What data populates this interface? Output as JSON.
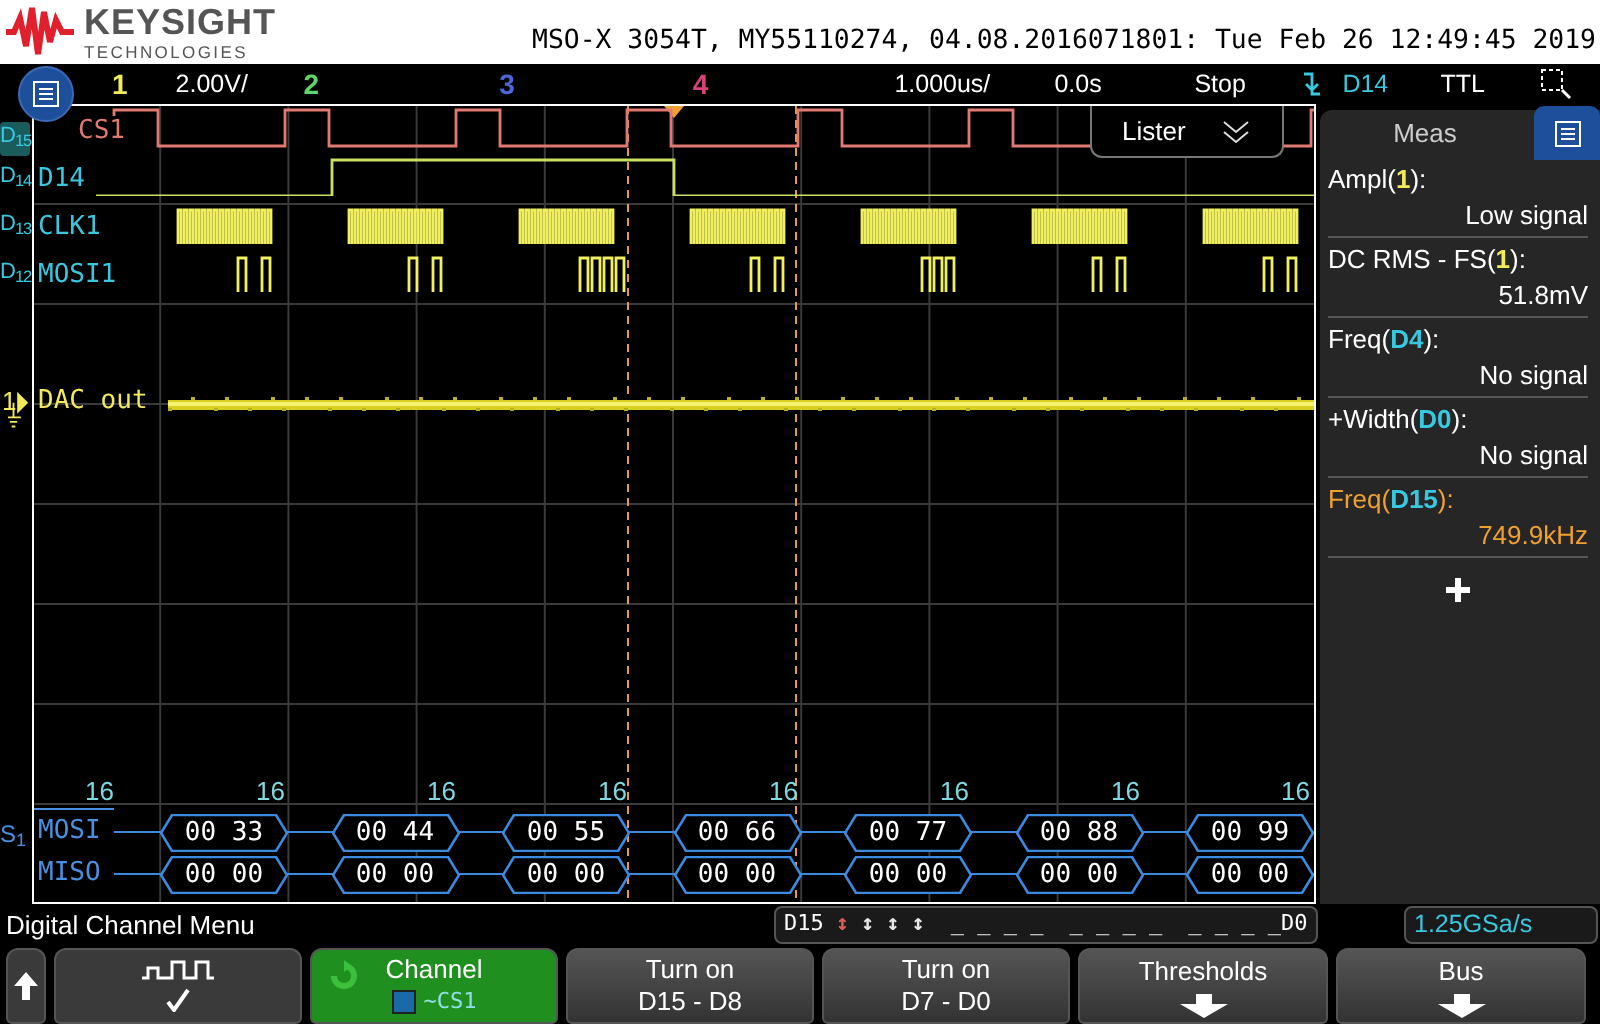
{
  "header": {
    "brand": "KEYSIGHT",
    "brand_sub": "TECHNOLOGIES",
    "title": "MSO-X 3054T, MY55110274, 04.08.2016071801: Tue Feb 26 12:49:45 2019"
  },
  "status_bar": {
    "channels": [
      {
        "label": "1",
        "color": "#f2ea5a"
      },
      {
        "label": "2",
        "color": "#5fd468"
      },
      {
        "label": "3",
        "color": "#4a66d8"
      },
      {
        "label": "4",
        "color": "#d8407a"
      }
    ],
    "scale": "2.00V/",
    "timebase": "1.000us/",
    "delay": "0.0s",
    "run_state": "Stop",
    "trigger_source": "D14",
    "trigger_level": "TTL"
  },
  "traces": [
    {
      "tag": "D$_{15}$",
      "label": "CS1",
      "kind": "select",
      "selected": true
    },
    {
      "tag": "D$_{14}$",
      "label": "D14",
      "kind": "gate",
      "selected": false
    },
    {
      "tag": "D$_{13}$",
      "label": "CLK1",
      "kind": "clock",
      "selected": false
    },
    {
      "tag": "D$_{12}$",
      "label": "MOSI1",
      "kind": "data",
      "selected": false
    }
  ],
  "analog": {
    "number": "1",
    "label": "DAC out"
  },
  "lister": {
    "label": "Lister"
  },
  "bus": {
    "tag": "S$_{1}$",
    "word_counts": [
      "16",
      "16",
      "16",
      "16",
      "16",
      "16",
      "16",
      "16"
    ],
    "rows": [
      {
        "label": "MOSI",
        "values": [
          "00 33",
          "00 44",
          "00 55",
          "00 66",
          "00 77",
          "00 88",
          "00 99"
        ]
      },
      {
        "label": "MISO",
        "values": [
          "00 00",
          "00 00",
          "00 00",
          "00 00",
          "00 00",
          "00 00",
          "00 00"
        ]
      }
    ]
  },
  "meas_panel": {
    "title": "Meas",
    "items": [
      {
        "prefix": "Ampl(",
        "source": "1",
        "color": "#f2ea5a",
        "suffix": "):",
        "value": "Low signal",
        "highlighted": false
      },
      {
        "prefix": "DC RMS - FS(",
        "source": "1",
        "color": "#f2ea5a",
        "suffix": "):",
        "value": "51.8mV",
        "highlighted": false
      },
      {
        "prefix": "Freq(",
        "source": "D4",
        "color": "#38c8e0",
        "suffix": "):",
        "value": "No signal",
        "highlighted": false
      },
      {
        "prefix": "+Width(",
        "source": "D0",
        "color": "#38c8e0",
        "suffix": "):",
        "value": "No signal",
        "highlighted": false
      },
      {
        "prefix": "Freq(",
        "source": "D15",
        "color": "#38c8e0",
        "suffix": "):",
        "value": "749.9kHz",
        "highlighted": true
      }
    ]
  },
  "menu": {
    "title": "Digital Channel Menu",
    "first_channel": "D15",
    "activity": [
      {
        "symbol": "↕",
        "color": "#e05a5a"
      },
      {
        "symbol": "↕",
        "color": "#e8e8e8"
      },
      {
        "symbol": "↕",
        "color": "#e8e8e8"
      },
      {
        "symbol": "↕",
        "color": "#e8e8e8"
      }
    ],
    "idle_groups": [
      "_ _ _ _",
      "_ _ _ _",
      "_ _ _ _"
    ],
    "last_channel": "D0",
    "sample_rate": "1.25GSa/s"
  },
  "softkeys": [
    {
      "kind": "up"
    },
    {
      "kind": "edge",
      "options": [
        {
          "selected": false
        },
        {
          "selected": true
        },
        {
          "selected": false
        }
      ]
    },
    {
      "kind": "channel",
      "title": "Channel",
      "value": "~CS1"
    },
    {
      "kind": "text",
      "line1": "Turn on",
      "line2": "D15 - D8"
    },
    {
      "kind": "text",
      "line1": "Turn on",
      "line2": "D7 - D0"
    },
    {
      "kind": "submenu",
      "label": "Thresholds"
    },
    {
      "kind": "submenu",
      "label": "Bus"
    }
  ]
}
